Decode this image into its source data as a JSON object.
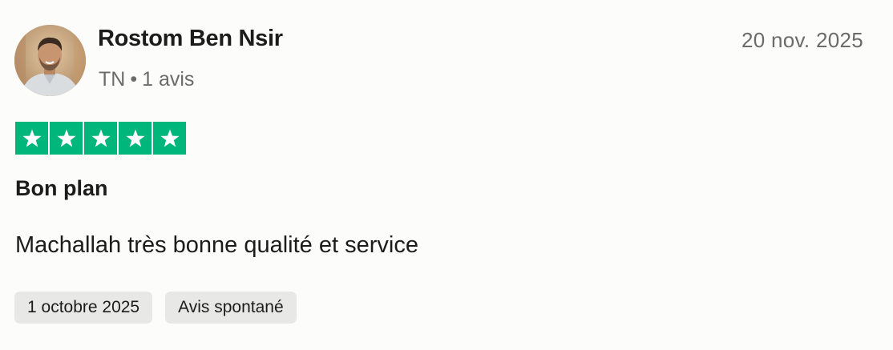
{
  "review": {
    "author": {
      "name": "Rostom Ben Nsir",
      "country": "TN",
      "separator": "•",
      "review_count": "1 avis",
      "avatar_icon": "user-avatar-photo"
    },
    "date": "20 nov. 2025",
    "rating": {
      "stars": 5,
      "max": 5,
      "color": "#00b67a",
      "icon": "star-icon"
    },
    "title": "Bon plan",
    "body": "Machallah très bonne qualité et service",
    "tags": [
      "1 octobre 2025",
      "Avis spontané"
    ]
  }
}
